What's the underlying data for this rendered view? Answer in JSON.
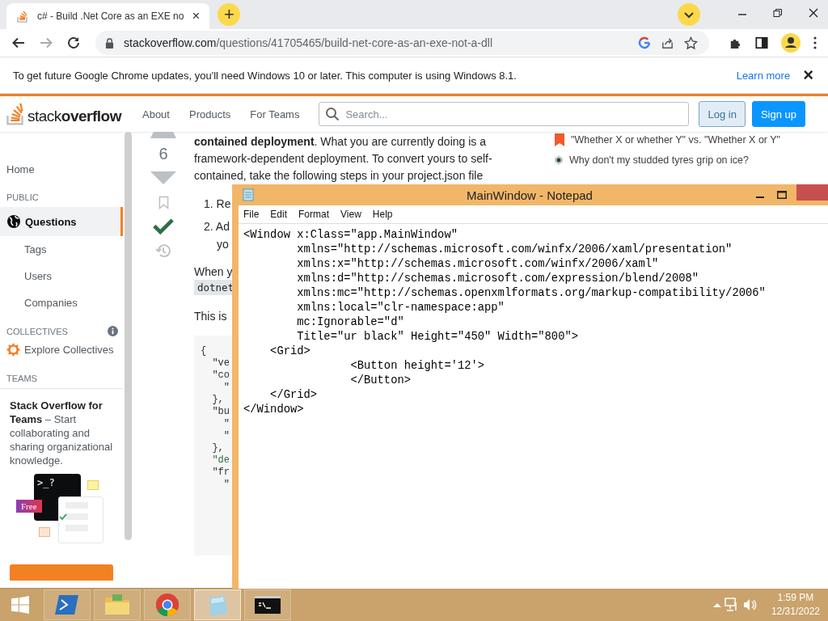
{
  "browser": {
    "tab": {
      "title": "c# - Build .Net Core as an EXE no",
      "close": "×"
    },
    "new_tab": "+",
    "url_host": "stackoverflow.com",
    "url_path": "/questions/41705465/build-net-core-as-an-exe-not-a-dll",
    "infobar": {
      "message": "To get future Google Chrome updates, you'll need Windows 10 or later. This computer is using Windows 8.1.",
      "link": "Learn more",
      "close": "×"
    }
  },
  "site": {
    "logo_light": "stack",
    "logo_bold": "overflow",
    "nav": [
      "About",
      "Products",
      "For Teams"
    ],
    "search": {
      "placeholder": "Search..."
    },
    "login": "Log in",
    "signup": "Sign up"
  },
  "sidebar": {
    "items": [
      {
        "kind": "link",
        "label": "Home",
        "selected": false
      },
      {
        "kind": "heading",
        "label": "PUBLIC"
      },
      {
        "kind": "link",
        "label": "Questions",
        "selected": true
      },
      {
        "kind": "sublink",
        "label": "Tags",
        "selected": false
      },
      {
        "kind": "sublink",
        "label": "Users",
        "selected": false
      },
      {
        "kind": "sublink",
        "label": "Companies",
        "selected": false
      },
      {
        "kind": "heading",
        "label": "COLLECTIVES",
        "info": true
      },
      {
        "kind": "collective",
        "label": "Explore Collectives",
        "selected": false
      },
      {
        "kind": "heading",
        "label": "TEAMS"
      }
    ],
    "teams_card": {
      "text": "**Stack Overflow for Teams** – Start collaborating and sharing organizational knowledge.",
      "badge": "Free",
      "prompt": ">_?"
    }
  },
  "answer": {
    "votes": "6",
    "accepted": true,
    "paragraphs": [
      "**contained deployment**. What you are currently doing is a",
      "framework-dependent deployment. To convert yours to self-",
      "contained, take the following steps in your project.json file"
    ],
    "steps": [
      "1. Re",
      "2. Ad",
      "yo"
    ],
    "after": "When y",
    "inline_code": "dotnet",
    "this_is": "This is",
    "code_lines": [
      "{",
      "  \"ve",
      "  \"co",
      "    \"",
      "  },",
      "  \"bu",
      "    \"",
      "    \"",
      "  },",
      "  \"de",
      "  \"fr",
      "    \""
    ]
  },
  "related": [
    {
      "kind": "bookmark",
      "title": "\"Whether X or whether Y\" vs. \"Whether X or Y\""
    },
    {
      "kind": "site",
      "title": "Why don't my studded tyres grip on ice?"
    }
  ],
  "notepad": {
    "title": "MainWindow - Notepad",
    "menu": [
      "File",
      "Edit",
      "Format",
      "View",
      "Help"
    ],
    "lines": [
      "<Window x:Class=\"app.MainWindow\"",
      "        xmlns=\"http://schemas.microsoft.com/winfx/2006/xaml/presentation\"",
      "        xmlns:x=\"http://schemas.microsoft.com/winfx/2006/xaml\"",
      "        xmlns:d=\"http://schemas.microsoft.com/expression/blend/2008\"",
      "        xmlns:mc=\"http://schemas.openxmlformats.org/markup-compatibility/2006\"",
      "        xmlns:local=\"clr-namespace:app\"",
      "        mc:Ignorable=\"d\"",
      "        Title=\"ur black\" Height=\"450\" Width=\"800\">",
      "    <Grid>",
      "                <Button height='12'>",
      "                </Button>",
      "    </Grid>",
      "</Window>"
    ]
  },
  "taskbar": {
    "apps": [
      {
        "kind": "powershell",
        "active": false
      },
      {
        "kind": "explorer",
        "active": false
      },
      {
        "kind": "chrome",
        "active": false
      },
      {
        "kind": "notepad",
        "active": true
      },
      {
        "kind": "cmd",
        "active": false
      }
    ],
    "time": "1:59 PM",
    "date": "12/31/2022"
  }
}
